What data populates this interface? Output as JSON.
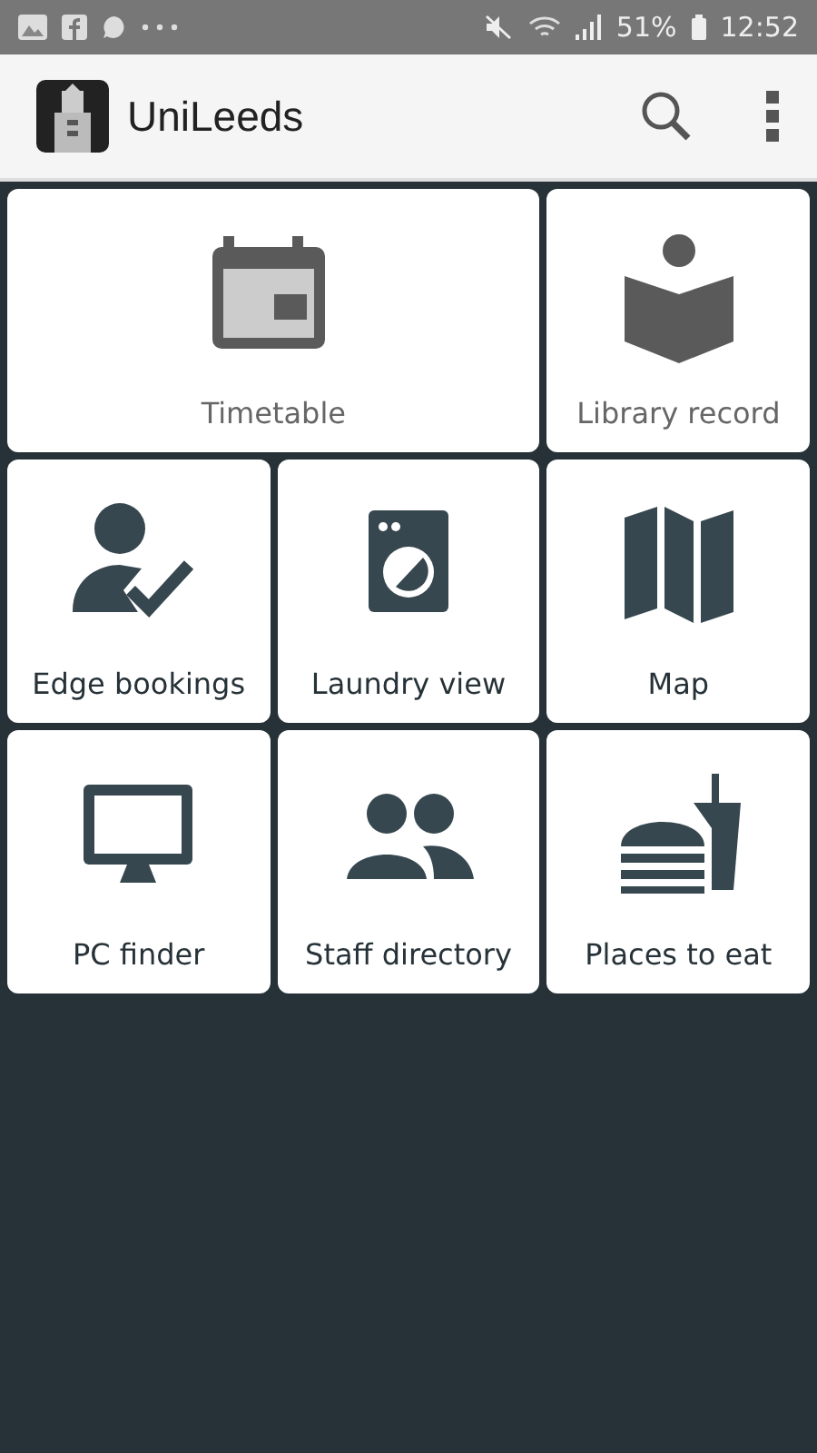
{
  "status_bar": {
    "battery": "51%",
    "time": "12:52"
  },
  "app_bar": {
    "title": "UniLeeds"
  },
  "tiles": [
    {
      "label": "Timetable",
      "disabled": true,
      "wide": true
    },
    {
      "label": "Library record",
      "disabled": true,
      "wide": false
    },
    {
      "label": "Edge bookings",
      "disabled": false,
      "wide": false
    },
    {
      "label": "Laundry view",
      "disabled": false,
      "wide": false
    },
    {
      "label": "Map",
      "disabled": false,
      "wide": false
    },
    {
      "label": "PC finder",
      "disabled": false,
      "wide": false
    },
    {
      "label": "Staff directory",
      "disabled": false,
      "wide": false
    },
    {
      "label": "Places to eat",
      "disabled": false,
      "wide": false
    }
  ]
}
